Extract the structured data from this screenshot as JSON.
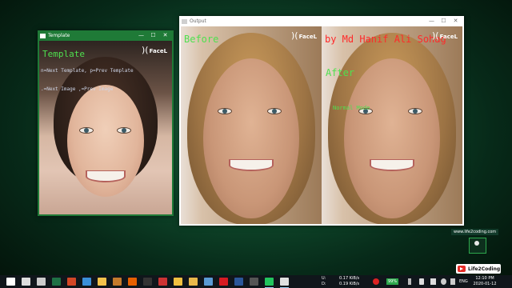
{
  "template_window": {
    "title": "Template",
    "controls": [
      "—",
      "☐",
      "✕"
    ],
    "overlay": {
      "heading": "Template",
      "line1": "n=Next Template, p=Prev Template",
      "line2": ".=Next Image ,=Prev Image",
      "logo": "FaceL"
    }
  },
  "output_window": {
    "title": "Output",
    "controls": [
      "—",
      "☐",
      "✕"
    ],
    "overlay": {
      "before_label": "Before",
      "byline": "by Md Hanif Ali Sohag",
      "after_label": "After",
      "normal_label": "Normal Mode",
      "logo_left": "FaceL",
      "logo_right": "FaceL"
    }
  },
  "watermark": {
    "url": "www.life2coding.com",
    "channel": "Life2Coding"
  },
  "taskbar": {
    "apps": [
      {
        "icon": "windows-start-icon",
        "color": "#ffffff"
      },
      {
        "icon": "search-icon",
        "color": "#dddddd"
      },
      {
        "icon": "task-view-icon",
        "color": "#cccccc"
      },
      {
        "icon": "excel-icon",
        "color": "#1e7145"
      },
      {
        "icon": "powerpoint-icon",
        "color": "#d24726"
      },
      {
        "icon": "media-player-icon",
        "color": "#3a8fd8"
      },
      {
        "icon": "file-explorer-icon",
        "color": "#f3c24b"
      },
      {
        "icon": "photos-icon",
        "color": "#c47a2c"
      },
      {
        "icon": "firefox-icon",
        "color": "#e66000"
      },
      {
        "icon": "terminal-icon",
        "color": "#333333"
      },
      {
        "icon": "screen-capture-icon",
        "color": "#cc3333"
      },
      {
        "icon": "python-icon",
        "color": "#f0c040"
      },
      {
        "icon": "folder-icon",
        "color": "#e8b84a"
      },
      {
        "icon": "store-icon",
        "color": "#5a9bd5"
      },
      {
        "icon": "opera-icon",
        "color": "#d61b22"
      },
      {
        "icon": "word-icon",
        "color": "#2b579a"
      },
      {
        "icon": "camera-icon",
        "color": "#555555"
      },
      {
        "icon": "pycharm-icon",
        "color": "#22c55e"
      },
      {
        "icon": "output-window-icon",
        "color": "#e0e0e0"
      }
    ],
    "net_up_label": "U:",
    "net_up_value": "0.17 KiB/s",
    "net_down_label": "D:",
    "net_down_value": "0.19 KiB/s",
    "battery": "99%",
    "language": "ENG",
    "time": "12:10 PM",
    "date": "2020-01-12"
  }
}
